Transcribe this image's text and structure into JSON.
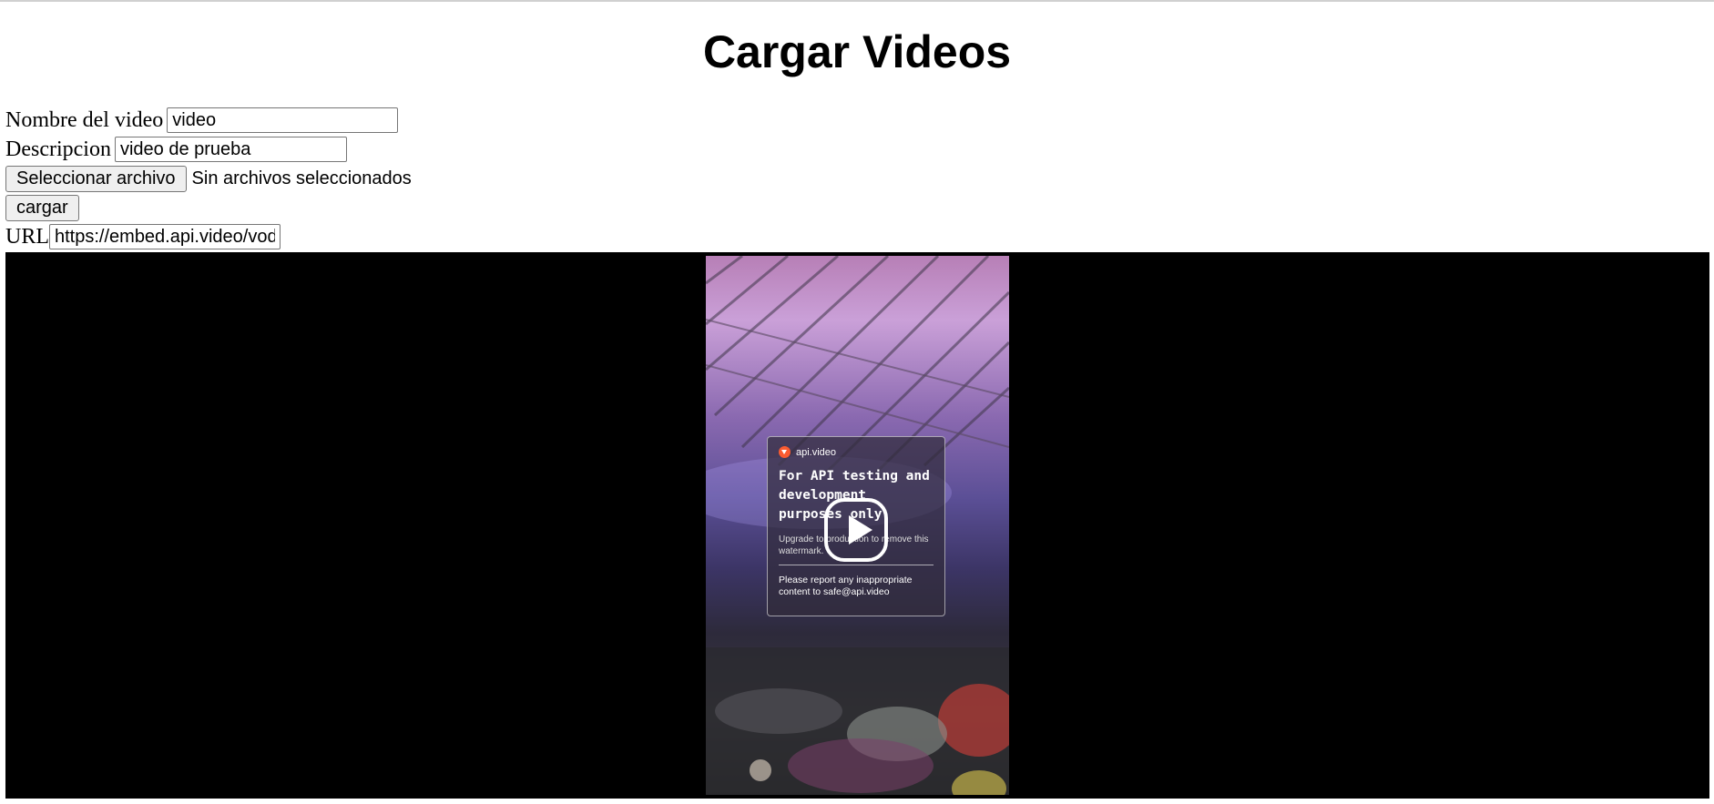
{
  "page": {
    "title": "Cargar Videos"
  },
  "form": {
    "name_label": "Nombre del video",
    "name_value": "video",
    "description_label": "Descripcion",
    "description_value": "video de prueba",
    "file_button_label": "Seleccionar archivo",
    "file_status": "Sin archivos seleccionados",
    "upload_button_label": "cargar",
    "url_label": "URL",
    "url_value": "https://embed.api.video/vod"
  },
  "player": {
    "watermark_brand": "api.video",
    "watermark_headline": "For API testing and development purposes only.",
    "watermark_subtext": "Upgrade to production to remove this watermark.",
    "watermark_report": "Please report any inappropriate content to safe@api.video",
    "play_icon": "play-icon"
  }
}
